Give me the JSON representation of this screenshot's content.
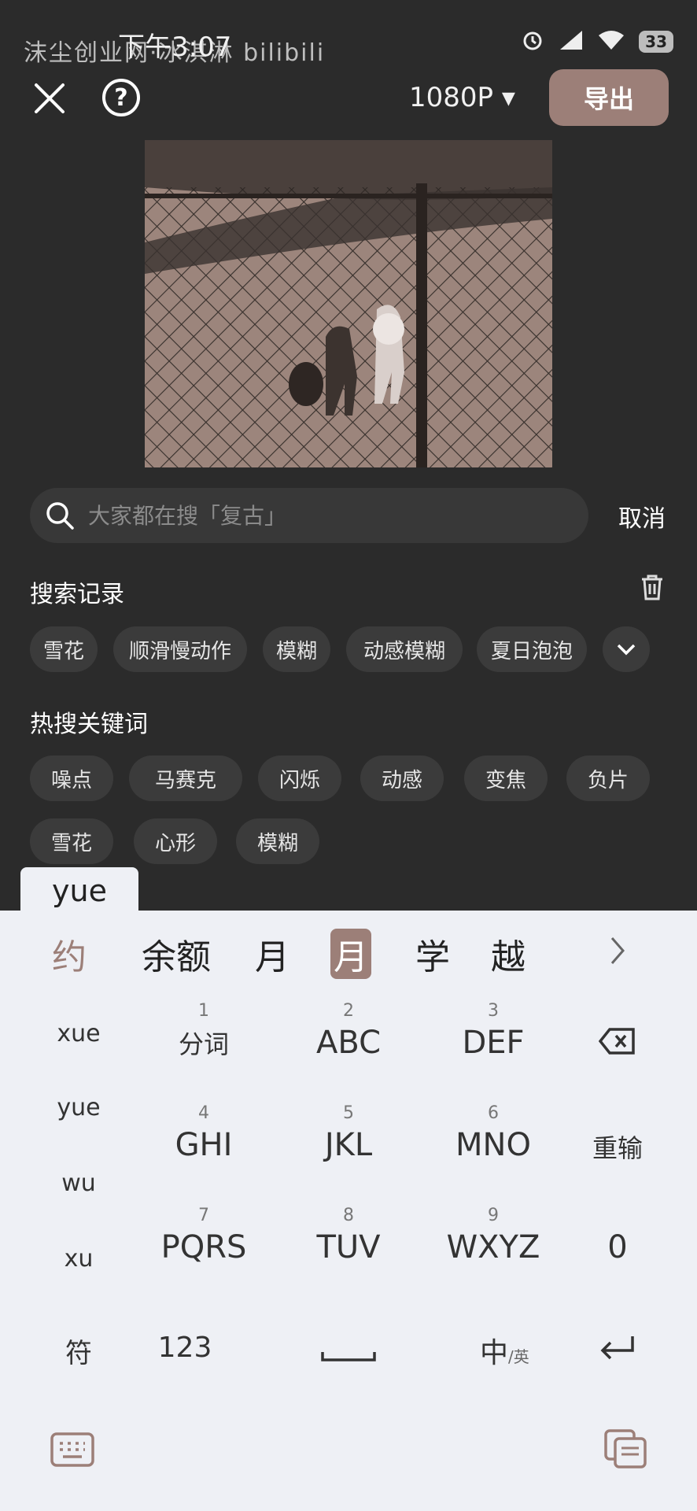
{
  "status": {
    "time": "下午3:07",
    "battery": "33"
  },
  "watermark": "沫尘创业网·冰淇淋 bilibili",
  "topbar": {
    "resolution": "1080P ▾",
    "export": "导出"
  },
  "search": {
    "placeholder": "大家都在搜「复古」",
    "cancel": "取消"
  },
  "history": {
    "title": "搜索记录",
    "items": [
      "雪花",
      "顺滑慢动作",
      "模糊",
      "动感模糊",
      "夏日泡泡"
    ]
  },
  "hot": {
    "title": "热搜关键词",
    "row1": [
      "噪点",
      "马赛克",
      "闪烁",
      "动感",
      "变焦",
      "负片"
    ],
    "row2": [
      "雪花",
      "心形",
      "模糊"
    ]
  },
  "keyboard": {
    "pinyin": "yue",
    "candidates": [
      "约",
      "余额",
      "月",
      "月",
      "学",
      "越"
    ],
    "left_col": [
      "xue",
      "yue",
      "wu",
      "xu"
    ],
    "keys": [
      {
        "num": "1",
        "label": "分词"
      },
      {
        "num": "2",
        "label": "ABC"
      },
      {
        "num": "3",
        "label": "DEF"
      },
      {
        "num": "4",
        "label": "GHI"
      },
      {
        "num": "5",
        "label": "JKL"
      },
      {
        "num": "6",
        "label": "MNO"
      },
      {
        "num": "7",
        "label": "PQRS"
      },
      {
        "num": "8",
        "label": "TUV"
      },
      {
        "num": "9",
        "label": "WXYZ"
      }
    ],
    "reinput": "重输",
    "zero": "0",
    "symbol": "符",
    "num123": "123",
    "lang_main": "中",
    "lang_sub": "/英"
  }
}
